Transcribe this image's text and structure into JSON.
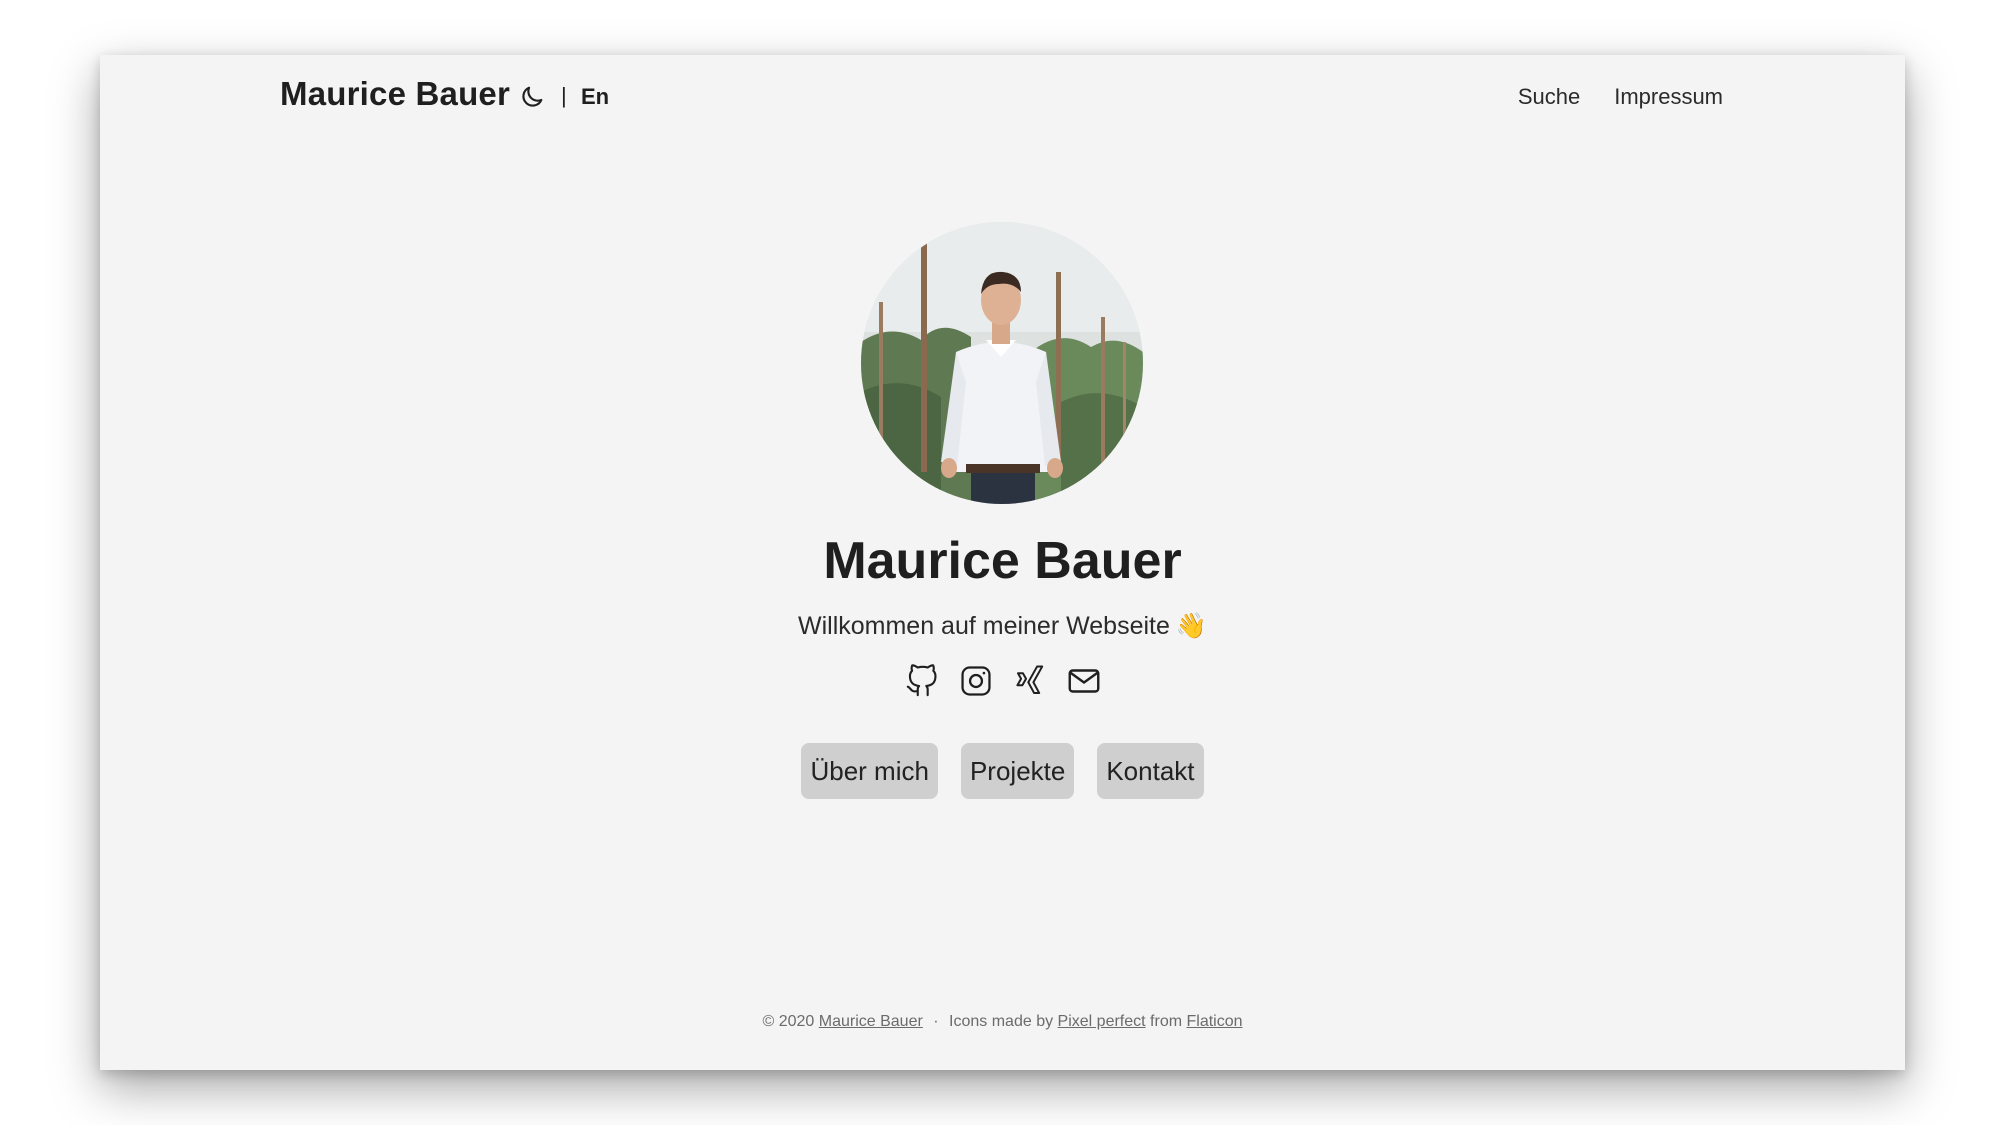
{
  "header": {
    "site_title": "Maurice Bauer",
    "theme_icon": "moon-icon",
    "lang_separator": "|",
    "lang_label": "En",
    "nav": [
      {
        "label": "Suche"
      },
      {
        "label": "Impressum"
      }
    ]
  },
  "hero": {
    "avatar_alt": "Maurice Bauer",
    "name": "Maurice Bauer",
    "tagline": "Willkommen auf meiner Webseite",
    "tagline_emoji": "👋",
    "social_icons": [
      "github-icon",
      "instagram-icon",
      "xing-icon",
      "mail-icon"
    ],
    "buttons": [
      {
        "label": "Über mich"
      },
      {
        "label": "Projekte"
      },
      {
        "label": "Kontakt"
      }
    ]
  },
  "footer": {
    "copyright": "© 2020",
    "author_link": "Maurice Bauer",
    "separator": "·",
    "icons_text": "Icons made by",
    "icons_author_link": "Pixel perfect",
    "from_text": "from",
    "source_link": "Flaticon"
  },
  "colors": {
    "page_bg": "#f4f4f4",
    "text": "#1f1f1f",
    "button_bg": "#cfcfcf",
    "footer_text": "#6b6b6b"
  }
}
